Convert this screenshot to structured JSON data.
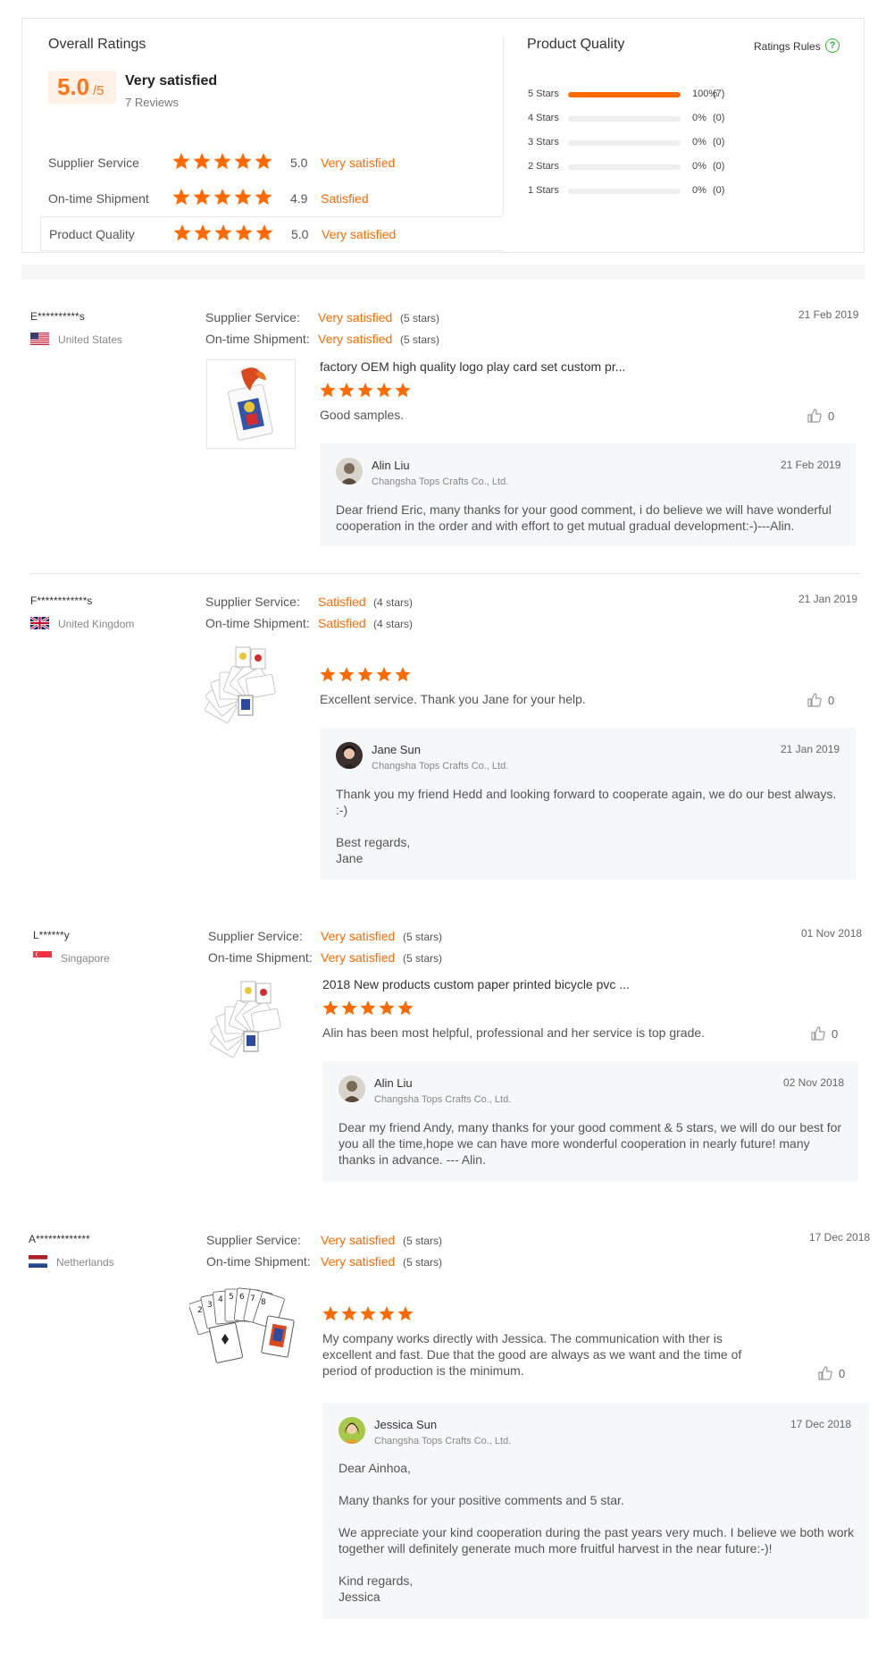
{
  "summary": {
    "overall_title": "Overall Ratings",
    "score": "5.0",
    "score_suffix": "/5",
    "level": "Very satisfied",
    "reviews_count": "7 Reviews",
    "rows": [
      {
        "label": "Supplier Service",
        "stars": 5,
        "value": "5.0",
        "level": "Very satisfied"
      },
      {
        "label": "On-time Shipment",
        "stars": 5,
        "value": "4.9",
        "level": "Satisfied"
      },
      {
        "label": "Product Quality",
        "stars": 5,
        "value": "5.0",
        "level": "Very satisfied"
      }
    ],
    "product_quality_title": "Product Quality",
    "rules_label": "Ratings Rules",
    "help_icon_glyph": "?",
    "distribution": [
      {
        "label": "5 Stars",
        "fraction": 1.0,
        "percent": "100%",
        "count": "(7)"
      },
      {
        "label": "4 Stars",
        "fraction": 0.0,
        "percent": "0%",
        "count": "(0)"
      },
      {
        "label": "3 Stars",
        "fraction": 0.0,
        "percent": "0%",
        "count": "(0)"
      },
      {
        "label": "2 Stars",
        "fraction": 0.0,
        "percent": "0%",
        "count": "(0)"
      },
      {
        "label": "1 Stars",
        "fraction": 0.0,
        "percent": "0%",
        "count": "(0)"
      }
    ]
  },
  "labels": {
    "supplier_service": "Supplier Service:",
    "ontime_shipment": "On-time Shipment:"
  },
  "reviews": [
    {
      "reviewer": "E**********s",
      "country": "United States",
      "flag": "us-flag",
      "supplier_level": "Very satisfied",
      "supplier_stars": "(5 stars)",
      "shipment_level": "Very satisfied",
      "shipment_stars": "(5 stars)",
      "date": "21 Feb 2019",
      "product_title": "factory OEM high quality logo play card set custom pr...",
      "rating": 5,
      "text": "Good samples.",
      "likes": "0",
      "reply": {
        "name": "Alin Liu",
        "company": "Changsha Tops Crafts Co., Ltd.",
        "date": "21 Feb 2019",
        "text": "Dear friend Eric, many thanks for your good comment,  i do believe we will have wonderful cooperation in the order and with effort to get mutual gradual development:-)---Alin."
      }
    },
    {
      "reviewer": "F************s",
      "country": "United Kingdom",
      "flag": "uk-flag",
      "supplier_level": "Satisfied",
      "supplier_stars": "(4 stars)",
      "shipment_level": "Satisfied",
      "shipment_stars": "(4 stars)",
      "date": "21 Jan 2019",
      "product_title": "",
      "rating": 5,
      "text": "Excellent service. Thank you Jane for your help.",
      "likes": "0",
      "reply": {
        "name": "Jane Sun",
        "company": "Changsha Tops Crafts Co., Ltd.",
        "date": "21 Jan 2019",
        "text": "Thank you my friend Hedd and looking forward to cooperate again, we do our best always. :-)\n\nBest regards,\nJane"
      }
    },
    {
      "reviewer": "L******y",
      "country": "Singapore",
      "flag": "sg-flag",
      "supplier_level": "Very satisfied",
      "supplier_stars": "(5 stars)",
      "shipment_level": "Very satisfied",
      "shipment_stars": "(5 stars)",
      "date": "01 Nov 2018",
      "product_title": "2018 New products custom paper printed bicycle pvc ...",
      "rating": 5,
      "text": "Alin has been most helpful, professional and her service is top grade.",
      "likes": "0",
      "reply": {
        "name": "Alin Liu",
        "company": "Changsha Tops Crafts Co., Ltd.",
        "date": "02 Nov 2018",
        "text": "Dear my friend Andy, many thanks for your good comment & 5 stars, we will do our best for you all the time,hope we can have more wonderful cooperation in nearly future! many thanks in advance. --- Alin."
      }
    },
    {
      "reviewer": "A*************",
      "country": "Netherlands",
      "flag": "nl-flag",
      "supplier_level": "Very satisfied",
      "supplier_stars": "(5 stars)",
      "shipment_level": "Very satisfied",
      "shipment_stars": "(5 stars)",
      "date": "17 Dec 2018",
      "product_title": "",
      "rating": 5,
      "text": "My company works directly with Jessica. The communication with ther is excellent and fast. Due that the good are always as we want and the time of period of production is the minimum.",
      "likes": "0",
      "reply": {
        "name": "Jessica Sun",
        "company": "Changsha Tops Crafts Co., Ltd.",
        "date": "17 Dec 2018",
        "text": "Dear Ainhoa,\n\nMany thanks for your positive comments and 5 star.\n\nWe appreciate your kind cooperation during the past years very much. I believe we both work together will definitely generate much more fruitful harvest in the near future:-)!\n\nKind regards,\nJessica"
      }
    }
  ],
  "colors": {
    "accent": "#ff6a00",
    "star": "#ff6a00",
    "reply_bg": "#f6f7f9"
  }
}
